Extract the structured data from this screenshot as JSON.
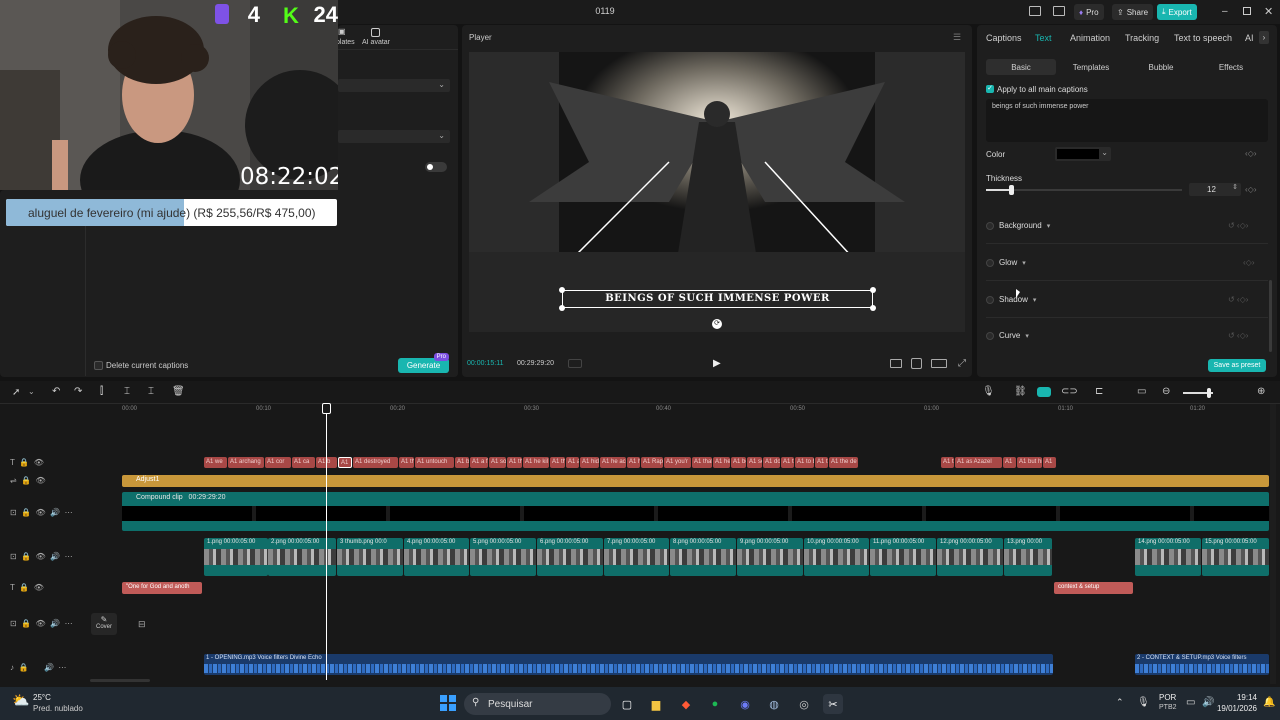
{
  "window": {
    "title": "0119",
    "pro_label": "Pro",
    "share_label": "Share",
    "export_label": "Export"
  },
  "overlay": {
    "counter_a": "4",
    "counter_b": "24",
    "clock": "08:22:02",
    "goal_text": "aluguel de fevereiro (mi ajude) (R$ 255,56/R$ 475,00)",
    "goal_progress": 0.538
  },
  "left_panel": {
    "tab_templates": "plates",
    "tab_ai_avatar": "AI avatar",
    "delete_captions_label": "Delete current captions",
    "generate_label": "Generate",
    "pro_tag": "Pro"
  },
  "player": {
    "title": "Player",
    "caption": "BEINGS OF SUCH IMMENSE POWER",
    "current_time": "00:00:15:11",
    "total_time": "00:29:29:20"
  },
  "right_panel": {
    "tabs": [
      "Captions",
      "Text",
      "Animation",
      "Tracking",
      "Text to speech",
      "AI"
    ],
    "active_tab": "Text",
    "subtabs": [
      "Basic",
      "Templates",
      "Bubble",
      "Effects"
    ],
    "apply_all_label": "Apply to all main captions",
    "text_value": "beings of such immense power",
    "color_label": "Color",
    "thickness_label": "Thickness",
    "thickness_value": "12",
    "thickness_fraction": 0.13,
    "sections": [
      "Background",
      "Glow",
      "Shadow",
      "Curve"
    ],
    "save_preset_label": "Save as preset",
    "accent": "#19b6b0"
  },
  "timeline": {
    "ruler": [
      "00:00",
      "00:10",
      "00:20",
      "00:30",
      "00:40",
      "00:50",
      "01:00",
      "01:10",
      "01:20"
    ],
    "caption_clips": [
      "A1 we",
      "A1 archang",
      "A1 cor",
      "A1 ca",
      "A1 b",
      "A1",
      "A1 destroyed",
      "A1 th",
      "A1 untouch",
      "A1 but",
      "A1 a fi",
      "A1 so c",
      "A1 the",
      "A1 he kil",
      "A1 the",
      "A1 a",
      "A1 hid",
      "A1 he acc",
      "A1 he",
      "A1 Rap",
      "A1 you'r",
      "A1 that y",
      "A1 he b",
      "A1 bo",
      "A1 se",
      "A1 don",
      "A1 t",
      "A1 to be",
      "A1 th",
      "A1 the de",
      "A1 th",
      "A1 as Azazel",
      "A1",
      "A1 but hi",
      "A1"
    ],
    "adjust_label": "Adjust1",
    "compound_label": "Compound clip",
    "compound_duration": "00:29:29:20",
    "image_clips": [
      {
        "label": "1.png  00:00:05:00"
      },
      {
        "label": "2.png  00:00:05:00"
      },
      {
        "label": "3 thumb.png  00:0"
      },
      {
        "label": "4.png  00:00:05:00"
      },
      {
        "label": "5.png  00:00:05:00"
      },
      {
        "label": "6.png  00:00:05:00"
      },
      {
        "label": "7.png  00:00:05:00"
      },
      {
        "label": "8.png  00:00:05:00"
      },
      {
        "label": "9.png  00:00:05:00"
      },
      {
        "label": "10.png  00:00:05:00"
      },
      {
        "label": "11.png  00:00:05:00"
      },
      {
        "label": "12.png  00:00:05:00"
      },
      {
        "label": "13.png  00:00"
      },
      {
        "label": "14.png  00:00:05:00"
      },
      {
        "label": "15.png  00:00:05:00"
      }
    ],
    "text_clip_1": "\"One for God and anoth",
    "text_clip_2": "context & setup",
    "cover_label": "Cover",
    "audio_1": "1 - OPENING.mp3    Voice filters Divine Echo",
    "audio_2": "2 - CONTEXT & SETUP.mp3    Voice filters"
  },
  "taskbar": {
    "weather_temp": "25°C",
    "weather_desc": "Pred. nublado",
    "search_placeholder": "Pesquisar",
    "lang": "POR",
    "lang_sub": "PTB2",
    "time": "19:14",
    "date": "19/01/2026"
  }
}
